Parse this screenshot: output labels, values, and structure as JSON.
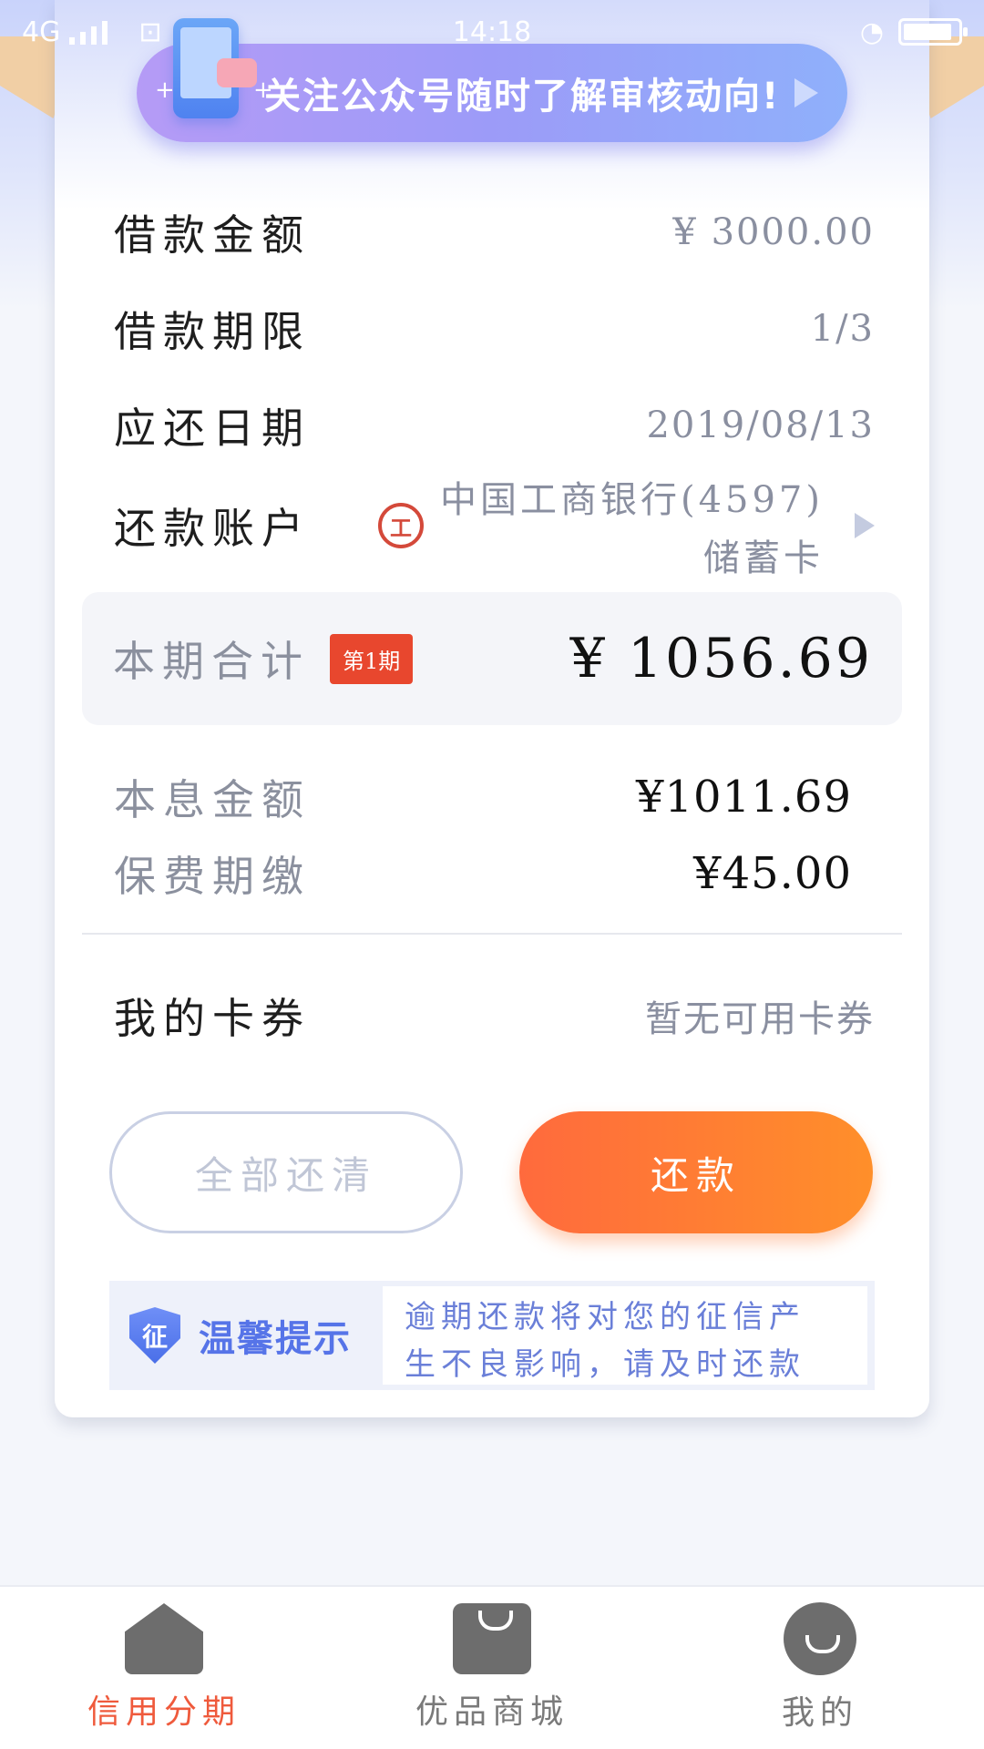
{
  "status_bar": {
    "network": "4G",
    "time": "14:18"
  },
  "banner": {
    "text": "关注公众号随时了解审核动向!"
  },
  "details": {
    "loan_amount": {
      "label": "借款金额",
      "value": "¥ 3000.00"
    },
    "loan_term": {
      "label": "借款期限",
      "value": "1/3"
    },
    "due_date": {
      "label": "应还日期",
      "value": "2019/08/13"
    },
    "account": {
      "label": "还款账户",
      "bank_name": "中国工商银行(4597)",
      "card_type": "储蓄卡",
      "bank_logo": "工"
    }
  },
  "period_total": {
    "label": "本期合计",
    "badge": "第1期",
    "amount": "¥ 1056.69"
  },
  "breakdown": {
    "principal_interest": {
      "label": "本息金额",
      "value": "¥1011.69"
    },
    "insurance_fee": {
      "label": "保费期缴",
      "value": "¥45.00"
    }
  },
  "coupons": {
    "label": "我的卡券",
    "value": "暂无可用卡券"
  },
  "buttons": {
    "repay_all": "全部还清",
    "repay": "还款"
  },
  "tip": {
    "icon_text": "征",
    "title": "温馨提示",
    "line1": "逾期还款将对您的征信产",
    "line2": "生不良影响，请及时还款"
  },
  "bottom_nav": {
    "items": [
      {
        "label": "信用分期",
        "icon": "home-icon",
        "active": true
      },
      {
        "label": "优品商城",
        "icon": "shopping-bag-icon",
        "active": false
      },
      {
        "label": "我的",
        "icon": "profile-icon",
        "active": false
      }
    ]
  },
  "colors": {
    "accent": "#ff7a35",
    "badge": "#e8472e",
    "active_nav": "#ef5a3c",
    "tip_blue": "#5674e8"
  }
}
